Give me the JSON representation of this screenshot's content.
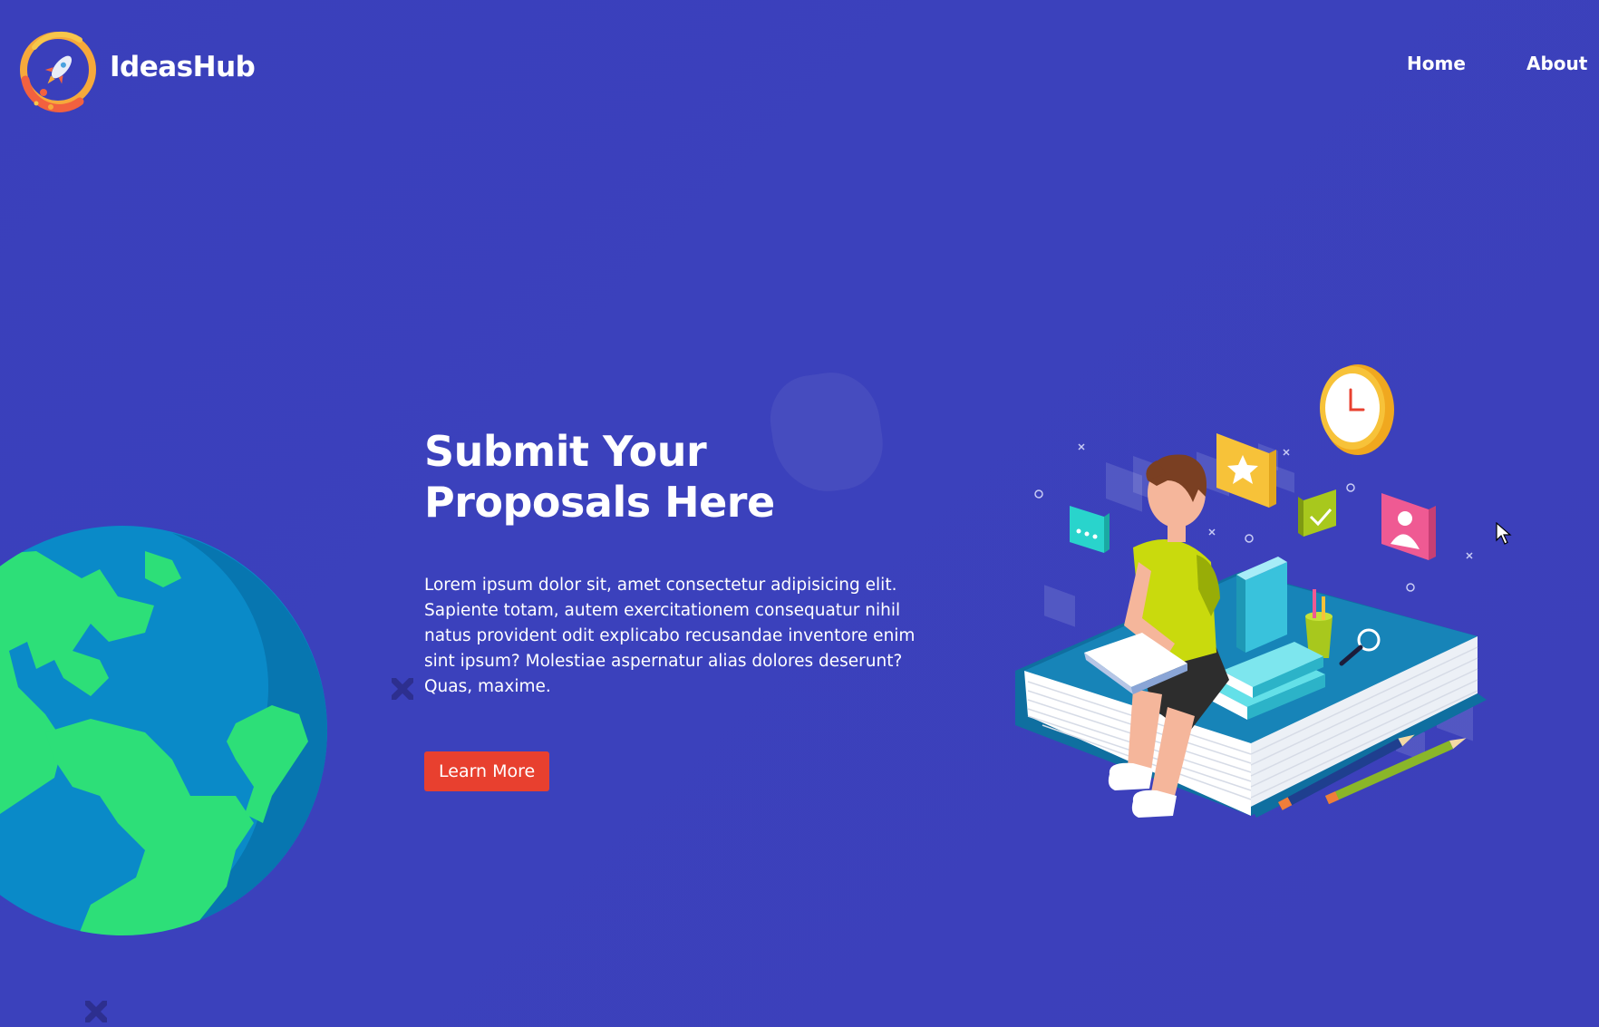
{
  "header": {
    "brand": "IdeasHub",
    "nav": {
      "home": "Home",
      "about": "About"
    }
  },
  "hero": {
    "title": "Submit Your Proposals Here",
    "body": "Lorem ipsum dolor sit, amet consectetur adipisicing elit. Sapiente totam, autem exercitationem consequatur nihil natus provident odit explicabo recusandae inventore enim sint ipsum? Molestiae aspernatur alias dolores deserunt? Quas, maxime.",
    "cta_label": "Learn More"
  },
  "colors": {
    "background": "#3a3fbb",
    "cta": "#e8402f",
    "text": "#ffffff"
  },
  "icons": [
    "rocket-logo-icon",
    "globe-icon",
    "reading-student-illustration",
    "clock-icon",
    "star-icon",
    "chat-icon",
    "check-icon",
    "user-icon",
    "cursor-icon"
  ]
}
